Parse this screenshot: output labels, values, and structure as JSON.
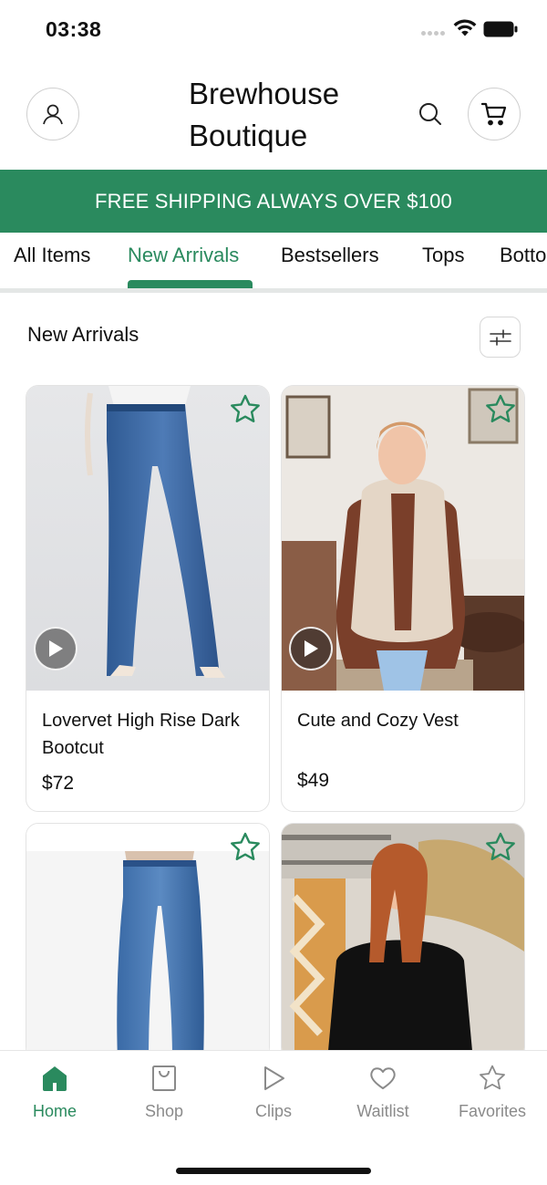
{
  "status_bar": {
    "time": "03:38",
    "icons": [
      "signal-icon",
      "wifi-icon",
      "battery-icon"
    ]
  },
  "header": {
    "title_line1": "Brewhouse",
    "title_line2": "Boutique",
    "icons": [
      "account-icon",
      "search-icon",
      "cart-icon"
    ]
  },
  "promo": {
    "text": "FREE SHIPPING ALWAYS OVER $100",
    "color": "#2a8a5e"
  },
  "tabs": [
    {
      "label": "All Items",
      "active": false
    },
    {
      "label": "New Arrivals",
      "active": true
    },
    {
      "label": "Bestsellers",
      "active": false
    },
    {
      "label": "Tops",
      "active": false
    },
    {
      "label": "Botto",
      "active": false
    }
  ],
  "section": {
    "title": "New Arrivals",
    "filter_icon": "sliders-icon"
  },
  "products": [
    {
      "name": "Lovervet High Rise Dark Bootcut",
      "price": "$72",
      "has_video": true,
      "favorite_icon": "star-outline-icon"
    },
    {
      "name": "Cute and Cozy Vest",
      "price": "$49",
      "has_video": true,
      "favorite_icon": "star-outline-icon"
    },
    {
      "name": "",
      "price": "",
      "has_video": false,
      "favorite_icon": "star-outline-icon"
    },
    {
      "name": "",
      "price": "",
      "has_video": false,
      "favorite_icon": "star-outline-icon"
    }
  ],
  "bottom_nav": [
    {
      "label": "Home",
      "icon": "home-icon",
      "active": true
    },
    {
      "label": "Shop",
      "icon": "shopping-bag-icon",
      "active": false
    },
    {
      "label": "Clips",
      "icon": "play-icon",
      "active": false
    },
    {
      "label": "Waitlist",
      "icon": "heart-icon",
      "active": false
    },
    {
      "label": "Favorites",
      "icon": "star-icon",
      "active": false
    }
  ],
  "colors": {
    "accent": "#2a8a5e",
    "inactive": "#8a8a8a",
    "text": "#111111"
  }
}
